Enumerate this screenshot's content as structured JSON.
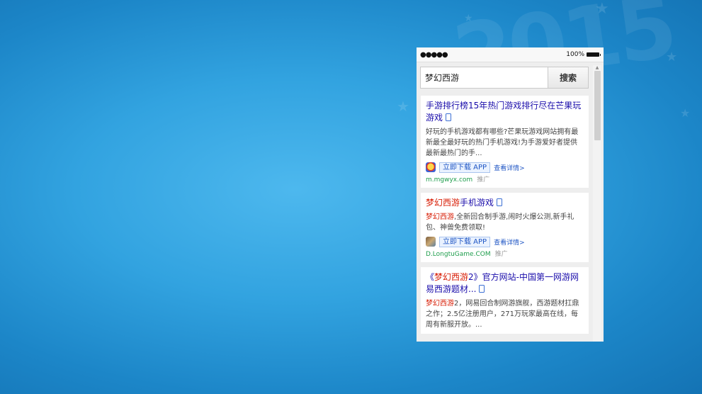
{
  "background": {
    "year_text": "2015",
    "primary_color": "#32a3e0"
  },
  "statusbar": {
    "signal": "●●●●●",
    "battery_text": "100%"
  },
  "search": {
    "value": "梦幻西游",
    "button_label": "搜索"
  },
  "results": [
    {
      "title_parts": [
        "手游排行榜15年热门游戏排行尽在芒果玩游戏"
      ],
      "desc": "好玩的手机游戏都有哪些?芒果玩游戏网站拥有最新最全最好玩的热门手机游戏!为手游爱好者提供最新最热门的手...",
      "download_label": "立即下载 APP",
      "detail_label": "查看详情>",
      "domain": "m.mgwyx.com",
      "ad_label": "推广"
    },
    {
      "title_hl": "梦幻西游",
      "title_rest": "手机游戏",
      "desc_hl": "梦幻西游",
      "desc_rest": ",全新回合制手游,闹时火爆公测,新手礼包、神兽免费领取!",
      "download_label": "立即下载 APP",
      "detail_label": "查看详情>",
      "domain": "D.LongtuGame.COM",
      "ad_label": "推广"
    },
    {
      "title_pre": "《",
      "title_hl": "梦幻西游",
      "title_rest": "2》官方网站-中国第一网游网易西游题材...",
      "desc_hl": "梦幻西游",
      "desc_rest": "2，网易回合制网游旗舰，西游题材扛鼎之作；2.5亿注册用户，271万玩家最高在线，每周有新服开放。..."
    }
  ]
}
